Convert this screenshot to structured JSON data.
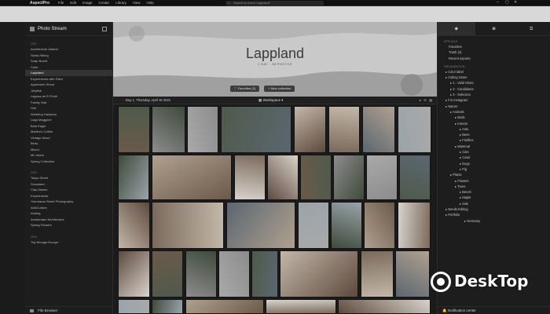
{
  "app": {
    "name": "AspectPro"
  },
  "menu": [
    "File",
    "Edit",
    "Image",
    "Create",
    "Library",
    "View",
    "Help"
  ],
  "search": {
    "placeholder": "Search in event 'Lappland'"
  },
  "left": {
    "title": "Photo Stream",
    "sections": [
      {
        "year": "2021",
        "items": [
          "Architecture Madrid",
          "Swiss Hiking",
          "Soap Brand",
          "Color",
          "Lappland",
          "Experiments with Paint",
          "Apartment Shoot",
          "Jellyfish",
          "Laguna de El Portil",
          "Family Visit",
          "Holi",
          "Wedding Hampton",
          "Lago Maggiore",
          "Bald Eagle",
          "Martha's Coffee",
          "Vintage Mood",
          "Birds",
          "Mixed",
          "ML Helos",
          "Spring Collection"
        ]
      },
      {
        "year": "2020",
        "items": [
          "Tokyo Street",
          "Snowland",
          "Clay Dishes",
          "Experiments",
          "Yokohama Street Photography",
          "Art&Culture",
          "Analog",
          "Amsterdam Architecture",
          "Spring Flowers"
        ]
      },
      {
        "year": "2019",
        "items": [
          "Trip through Europe"
        ]
      }
    ],
    "active": "Lappland",
    "footer": "File Browser"
  },
  "hero": {
    "title": "Lappland",
    "subtitle": "1 DAY · 38 PHOTOS",
    "favorites_btn": "Favorites (3)",
    "new_collection_btn": "New collection"
  },
  "strip": {
    "date": "Day 1, Thursday, April 15 2021",
    "workspace": "Workspace"
  },
  "right": {
    "specials_label": "SPECIALS",
    "specials": [
      "Favorites",
      "Trash (4)",
      "Recent imports"
    ],
    "organization_label": "ORGANIZATION",
    "tree": [
      "Color label",
      "Culling Stone",
      "1 - Valid Shots",
      "2 - Candidates",
      "3 - Selection",
      "For instagram",
      "Nature",
      "Animals",
      "Birds",
      "Insects",
      "Ants",
      "Bees",
      "Fireflies",
      "Mammal",
      "Cats",
      "Cows",
      "Dogs",
      "Pig",
      "Plants",
      "Flowers",
      "Trees",
      "Beech",
      "Maple",
      "Oak",
      "Needs Editing",
      "Portfolio",
      "Germany"
    ],
    "footer": "Notification center"
  },
  "watermark": "DeskTop"
}
